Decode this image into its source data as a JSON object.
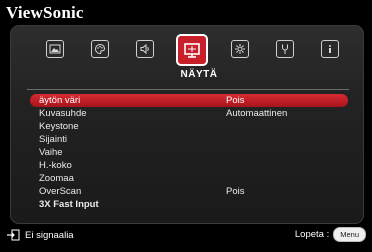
{
  "brand": "ViewSonic",
  "tabs": [
    {
      "icon": "picture-icon",
      "active": false
    },
    {
      "icon": "color-palette-icon",
      "active": false
    },
    {
      "icon": "audio-icon",
      "active": false
    },
    {
      "icon": "display-icon",
      "active": true,
      "label": "NÄYTÄ"
    },
    {
      "icon": "settings-icon",
      "active": false
    },
    {
      "icon": "advanced-icon",
      "active": false
    },
    {
      "icon": "information-icon",
      "active": false
    }
  ],
  "menu": {
    "items": [
      {
        "label": "äytön väri",
        "value": "Pois",
        "selected": true
      },
      {
        "label": "Kuvasuhde",
        "value": "Automaattinen"
      },
      {
        "label": "Keystone",
        "value": ""
      },
      {
        "label": "Sijainti",
        "value": ""
      },
      {
        "label": "Vaihe",
        "value": ""
      },
      {
        "label": "H.-koko",
        "value": ""
      },
      {
        "label": "Zoomaa",
        "value": ""
      },
      {
        "label": "OverScan",
        "value": "Pois"
      },
      {
        "label": "3X Fast Input",
        "value": ""
      }
    ]
  },
  "footer": {
    "status": "Ei signaalia",
    "exit_label": "Lopeta :",
    "menu_button": "Menu"
  },
  "colors": {
    "accent": "#c8202a",
    "panel": "#262626"
  }
}
